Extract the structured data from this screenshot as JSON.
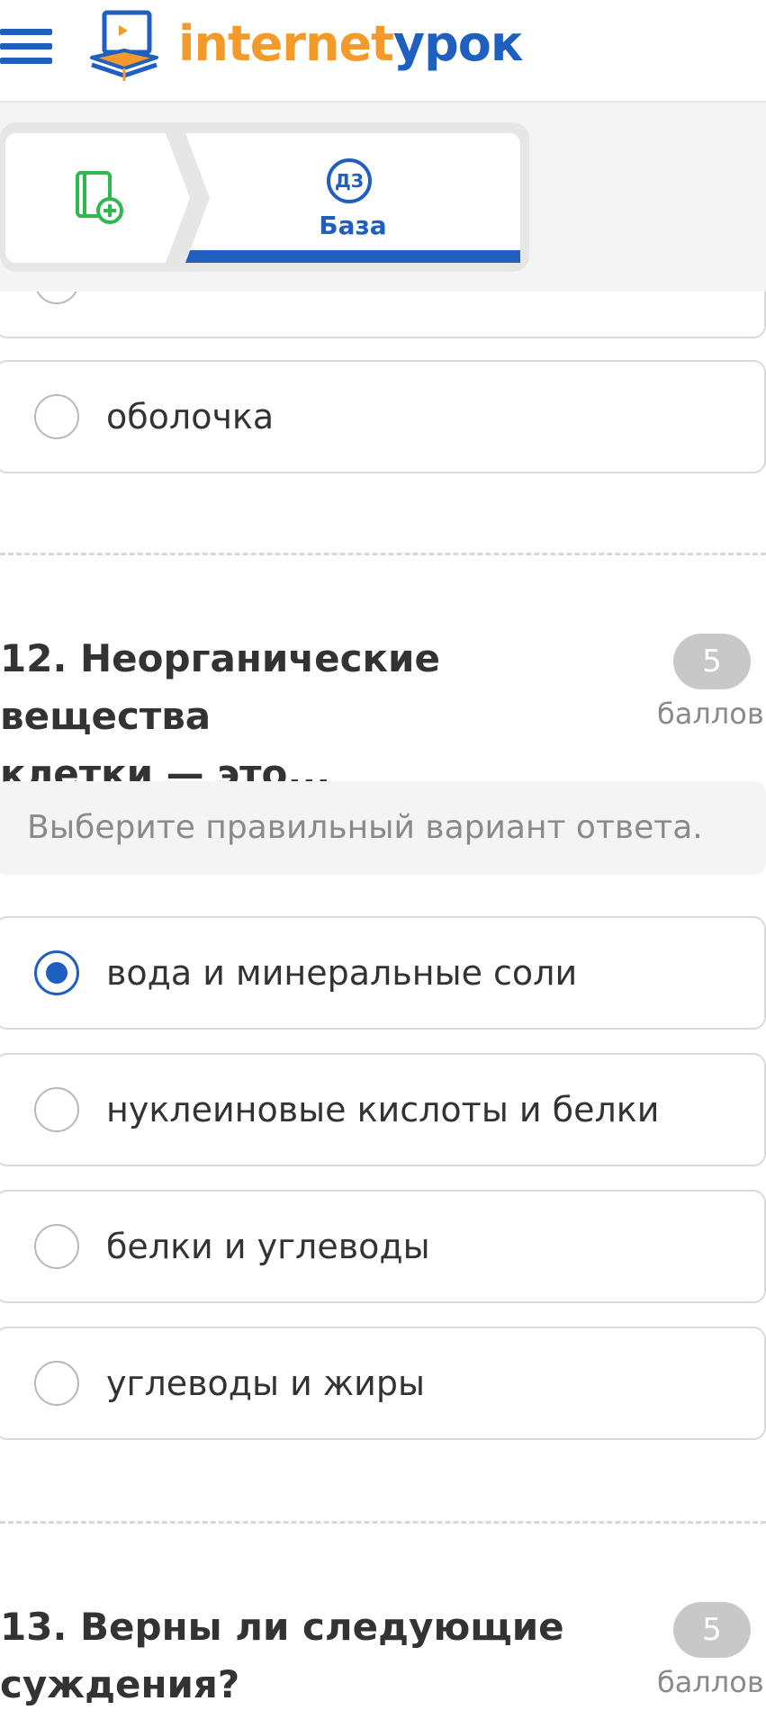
{
  "header": {
    "brand_part1": "internet",
    "brand_part2": "урок",
    "menu_icon": "hamburger-icon",
    "logo_icon": "book-laptop-logo-icon"
  },
  "tabs": {
    "add_icon": "add-notebook-icon",
    "base_badge": "ДЗ",
    "base_label": "База"
  },
  "colors": {
    "accent_blue": "#1f5fbf",
    "brand_orange": "#f39a2b",
    "add_icon_green": "#2eb84f",
    "border_gray": "#d9d9d9"
  },
  "previous_question": {
    "options": [
      {
        "label": "",
        "selected": false
      },
      {
        "label": "оболочка",
        "selected": false
      }
    ]
  },
  "question12": {
    "title_line1": "12. Неорганические вещества",
    "title_line2": "клетки — это...",
    "score": "5",
    "score_label": "баллов",
    "hint": "Выберите правильный вариант ответа.",
    "options": [
      {
        "label": "вода и минеральные соли",
        "selected": true
      },
      {
        "label": "нуклеиновые кислоты и белки",
        "selected": false
      },
      {
        "label": "белки и углеводы",
        "selected": false
      },
      {
        "label": "углеводы и жиры",
        "selected": false
      }
    ]
  },
  "question13": {
    "title_line1": "13. Верны ли следующие",
    "title_line2": "суждения?",
    "score": "5",
    "score_label": "баллов"
  }
}
